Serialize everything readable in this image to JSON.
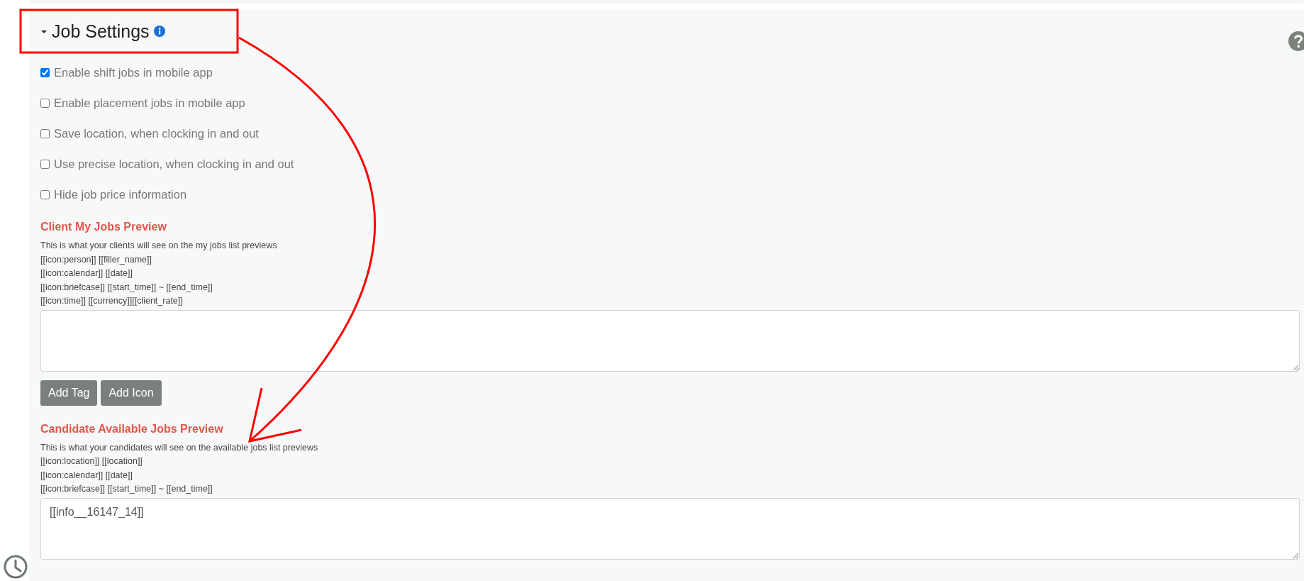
{
  "section": {
    "title": "Job Settings",
    "expanded": true
  },
  "options": [
    {
      "label": "Enable shift jobs in mobile app",
      "checked": true
    },
    {
      "label": "Enable placement jobs in mobile app",
      "checked": false
    },
    {
      "label": "Save location, when clocking in and out",
      "checked": false
    },
    {
      "label": "Use precise location, when clocking in and out",
      "checked": false
    },
    {
      "label": "Hide job price information",
      "checked": false
    }
  ],
  "previews": [
    {
      "heading": "Client My Jobs Preview",
      "description": "This is what your clients will see on the my jobs list previews",
      "template_lines": [
        "[[icon:person]] [[filler_name]]",
        "[[icon:calendar]] [[date]]",
        "[[icon:briefcase]] [[start_time]] ~ [[end_time]]",
        "[[icon:time]] [[currency]][[client_rate]]"
      ],
      "buttons": [
        "Add Tag",
        "Add Icon"
      ]
    },
    {
      "heading": "Candidate Available Jobs Preview",
      "description": "This is what your candidates will see on the available jobs list previews",
      "template_lines": [
        "[[icon:location]] [[location]]",
        "[[icon:calendar]] [[date]]",
        "[[icon:briefcase]] [[start_time]] ~ [[end_time]]"
      ],
      "value": "[[info__16147_14]]"
    }
  ]
}
